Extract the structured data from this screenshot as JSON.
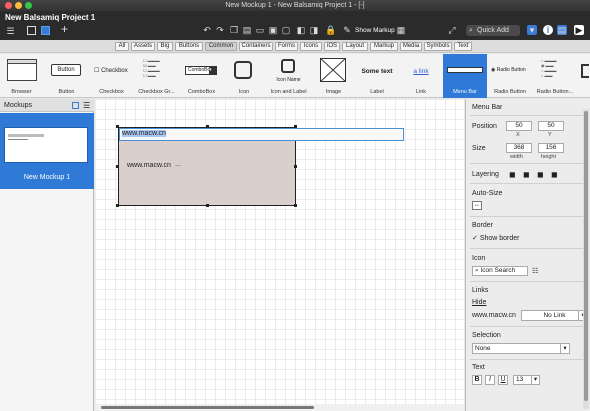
{
  "window": {
    "title": "New Mockup 1 - New Balsamiq Project 1 - [-]",
    "project": "New Balsamiq Project 1"
  },
  "toolbar": {
    "show_markup": "Show Markup",
    "quick_add": "Quick Add"
  },
  "filters": [
    "All",
    "Assets",
    "Big",
    "Buttons",
    "Common",
    "Containers",
    "Forms",
    "Icons",
    "iOS",
    "Layout",
    "Markup",
    "Media",
    "Symbols",
    "Text"
  ],
  "filter_selected": "Common",
  "library": [
    {
      "label": "Browser"
    },
    {
      "label": "Button",
      "inner": "Button"
    },
    {
      "label": "Checkbox",
      "inner": "Checkbox"
    },
    {
      "label": "Checkbox Gr..."
    },
    {
      "label": "ComboBox",
      "inner": "ComboBox"
    },
    {
      "label": "Icon"
    },
    {
      "label": "Icon and Label",
      "inner": "Icon Name"
    },
    {
      "label": "Image"
    },
    {
      "label": "Label",
      "inner": "Some text"
    },
    {
      "label": "Link",
      "inner": "a link"
    },
    {
      "label": "Menu Bar"
    },
    {
      "label": "Radio Button",
      "inner": "Radio Button"
    },
    {
      "label": "Radio Button..."
    }
  ],
  "left_panel": {
    "title": "Mockups",
    "item": "New Mockup 1"
  },
  "canvas": {
    "menubar_text": "www.macw.cn",
    "inner_text": "www.macw.cn"
  },
  "inspector": {
    "title": "Menu Bar",
    "position_label": "Position",
    "x": "50",
    "y": "50",
    "x_label": "X",
    "y_label": "Y",
    "size_label": "Size",
    "width": "368",
    "height": "156",
    "width_label": "width",
    "height_label": "height",
    "layering": "Layering",
    "autosize": "Auto-Size",
    "border": "Border",
    "show_border": "Show border",
    "icon": "Icon",
    "icon_search": "Icon Search",
    "links": "Links",
    "hide": "Hide",
    "link_site": "www.macw.cn",
    "no_link": "No Link",
    "selection": "Selection",
    "selection_value": "None",
    "text": "Text",
    "font_size": "13"
  }
}
